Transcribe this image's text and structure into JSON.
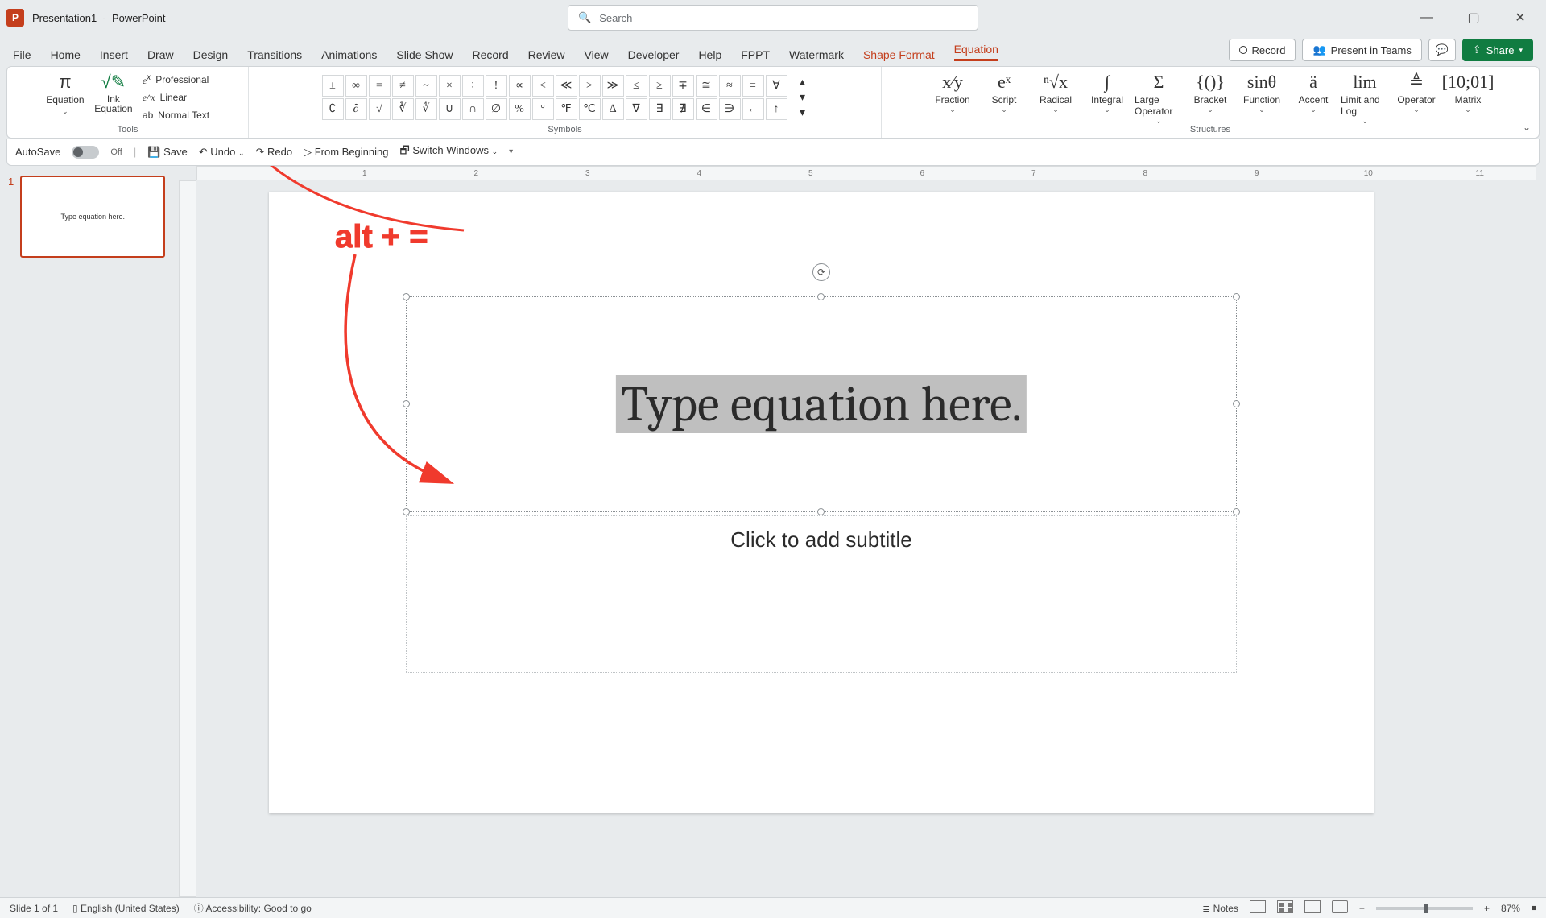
{
  "titlebar": {
    "doc": "Presentation1",
    "app": "PowerPoint",
    "search_placeholder": "Search"
  },
  "window_buttons": {
    "min": "—",
    "max": "▢",
    "close": "✕"
  },
  "tabs": [
    "File",
    "Home",
    "Insert",
    "Draw",
    "Design",
    "Transitions",
    "Animations",
    "Slide Show",
    "Record",
    "Review",
    "View",
    "Developer",
    "Help",
    "FPPT",
    "Watermark",
    "Shape Format",
    "Equation"
  ],
  "tab_right": {
    "record": "Record",
    "present": "Present in Teams",
    "comments_icon": "💬",
    "share": "Share"
  },
  "ribbon": {
    "tools_label": "Tools",
    "equation_btn": "Equation",
    "ink_btn": "Ink Equation",
    "conv": {
      "professional": "Professional",
      "linear": "Linear",
      "normal": "Normal Text"
    },
    "symbols_label": "Symbols",
    "symbols_row1": [
      "±",
      "∞",
      "=",
      "≠",
      "~",
      "×",
      "÷",
      "!",
      "∝",
      "<",
      "≪",
      ">",
      "≫",
      "≤",
      "≥",
      "∓",
      "≅",
      "≈",
      "≡",
      "∀"
    ],
    "symbols_row2": [
      "∁",
      "∂",
      "√",
      "∛",
      "∜",
      "∪",
      "∩",
      "∅",
      "%",
      "°",
      "℉",
      "℃",
      "∆",
      "∇",
      "∃",
      "∄",
      "∈",
      "∋",
      "←",
      "↑"
    ],
    "structures_label": "Structures",
    "structs": [
      {
        "icon": "x⁄y",
        "label": "Fraction"
      },
      {
        "icon": "eˣ",
        "label": "Script"
      },
      {
        "icon": "ⁿ√x",
        "label": "Radical"
      },
      {
        "icon": "∫",
        "label": "Integral"
      },
      {
        "icon": "Σ",
        "label": "Large Operator"
      },
      {
        "icon": "{()}",
        "label": "Bracket"
      },
      {
        "icon": "sinθ",
        "label": "Function"
      },
      {
        "icon": "ä",
        "label": "Accent"
      },
      {
        "icon": "lim",
        "label": "Limit and Log"
      },
      {
        "icon": "≜",
        "label": "Operator"
      },
      {
        "icon": "[10;01]",
        "label": "Matrix"
      }
    ]
  },
  "qat": {
    "autosave": "AutoSave",
    "autosave_state": "Off",
    "save": "Save",
    "undo": "Undo",
    "redo": "Redo",
    "from_beginning": "From Beginning",
    "switch": "Switch Windows"
  },
  "ruler_marks": [
    "",
    "1",
    "2",
    "3",
    "4",
    "5",
    "6",
    "7",
    "8",
    "9",
    "10",
    "11"
  ],
  "thumb": {
    "number": "1",
    "text": "Type equation here."
  },
  "slide": {
    "equation_placeholder": "Type equation here.",
    "subtitle_placeholder": "Click to add subtitle"
  },
  "annotation": {
    "text": "alt + ="
  },
  "status": {
    "slide": "Slide 1 of 1",
    "lang": "English (United States)",
    "accessibility": "Accessibility: Good to go",
    "notes": "Notes",
    "zoom": "87%"
  }
}
